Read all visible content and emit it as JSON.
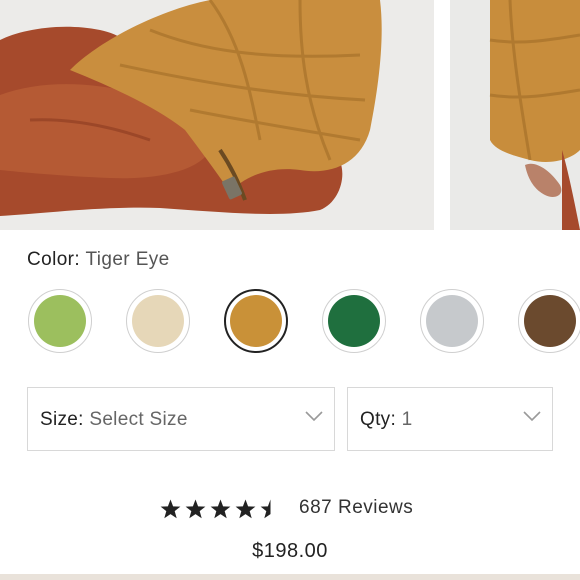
{
  "gallery": {
    "images": [
      {
        "name": "product-photo-main",
        "alt": "model seated wearing quilted jacket"
      },
      {
        "name": "product-photo-next",
        "alt": "quilted jacket sleeve detail"
      }
    ]
  },
  "color": {
    "key": "Color:",
    "selected": "Tiger Eye",
    "swatches": [
      {
        "color": "#9cbf5e",
        "selected": false
      },
      {
        "color": "#e6d7b8",
        "selected": false
      },
      {
        "color": "#c99138",
        "selected": true
      },
      {
        "color": "#1f6f3e",
        "selected": false
      },
      {
        "color": "#c6c9cc",
        "selected": false
      },
      {
        "color": "#6b4a2e",
        "selected": false
      }
    ]
  },
  "size": {
    "key": "Size:",
    "value": "Select Size"
  },
  "qty": {
    "key": "Qty:",
    "value": "1"
  },
  "rating": {
    "stars": 4.5,
    "max": 5,
    "reviews": "687 Reviews"
  },
  "price": "$198.00",
  "colors": {
    "star": "#222222",
    "border": "#d8d8d8",
    "chevron": "#9a9a9a"
  }
}
